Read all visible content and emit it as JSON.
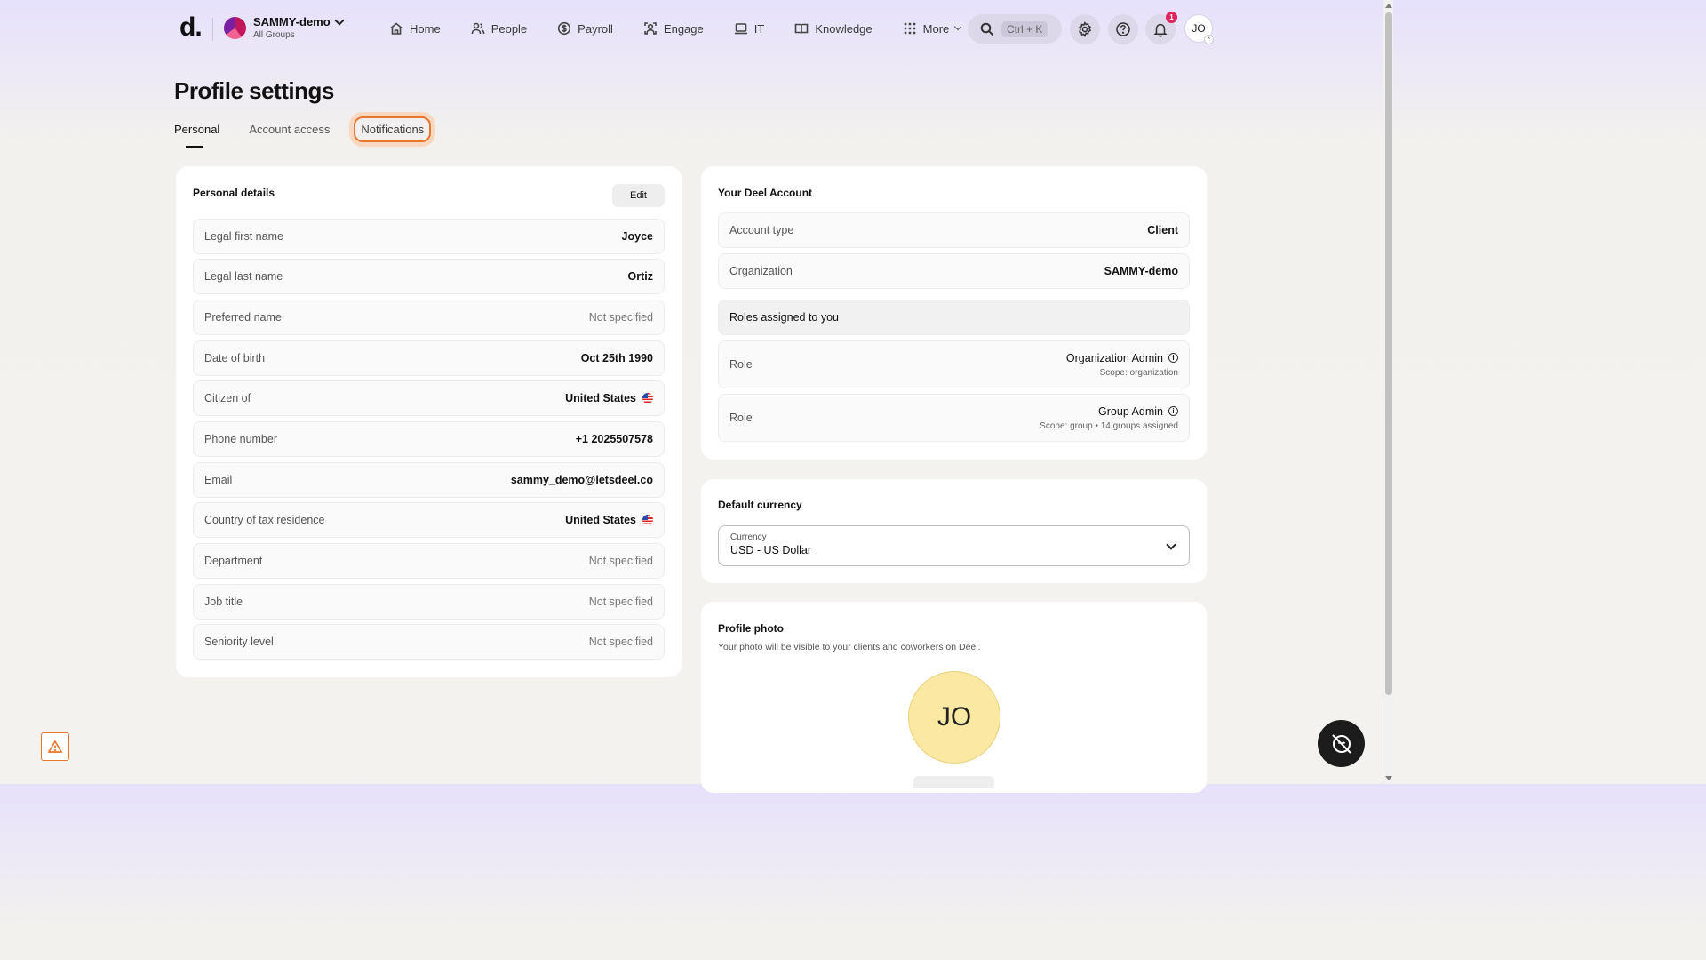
{
  "header": {
    "logo": "d.",
    "org_name": "SAMMY-demo",
    "org_sub": "All Groups",
    "nav": [
      {
        "label": "Home",
        "icon": "home-icon"
      },
      {
        "label": "People",
        "icon": "people-icon"
      },
      {
        "label": "Payroll",
        "icon": "payroll-icon"
      },
      {
        "label": "Engage",
        "icon": "engage-icon"
      },
      {
        "label": "IT",
        "icon": "laptop-icon"
      },
      {
        "label": "Knowledge",
        "icon": "book-icon"
      },
      {
        "label": "More",
        "icon": "grid-icon"
      }
    ],
    "search_shortcut": "Ctrl + K",
    "notification_count": "1",
    "user_initials": "JO"
  },
  "page": {
    "title": "Profile settings",
    "tabs": [
      "Personal",
      "Account access",
      "Notifications"
    ]
  },
  "personal": {
    "title": "Personal details",
    "edit_label": "Edit",
    "rows": [
      {
        "label": "Legal first name",
        "value": "Joyce"
      },
      {
        "label": "Legal last name",
        "value": "Ortiz"
      },
      {
        "label": "Preferred name",
        "value": "Not specified"
      },
      {
        "label": "Date of birth",
        "value": "Oct 25th 1990"
      },
      {
        "label": "Citizen of",
        "value": "United States"
      },
      {
        "label": "Phone number",
        "value": "+1 2025507578"
      },
      {
        "label": "Email",
        "value": "sammy_demo@letsdeel.co"
      },
      {
        "label": "Country of tax residence",
        "value": "United States"
      },
      {
        "label": "Department",
        "value": "Not specified"
      },
      {
        "label": "Job title",
        "value": "Not specified"
      },
      {
        "label": "Seniority level",
        "value": "Not specified"
      }
    ]
  },
  "account": {
    "title": "Your Deel Account",
    "account_type_label": "Account type",
    "account_type": "Client",
    "organization_label": "Organization",
    "organization": "SAMMY-demo",
    "roles_header": "Roles assigned to you",
    "roles": [
      {
        "label": "Role",
        "name": "Organization Admin",
        "scope": "Scope: organization"
      },
      {
        "label": "Role",
        "name": "Group Admin",
        "scope": "Scope: group • 14 groups assigned"
      }
    ]
  },
  "currency": {
    "title": "Default currency",
    "field_label": "Currency",
    "value": "USD - US Dollar"
  },
  "photo": {
    "title": "Profile photo",
    "description": "Your photo will be visible to your clients and coworkers on Deel.",
    "initials": "JO"
  },
  "colors": {
    "accent_focus": "#e8782d",
    "badge": "#e0245e",
    "avatar_bg": "#fbe8a2"
  }
}
